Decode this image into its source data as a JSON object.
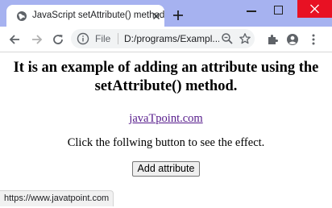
{
  "tab": {
    "title": "JavaScript setAttribute() method"
  },
  "omnibox": {
    "scheme_label": "File",
    "url": "D:/programs/Exampl..."
  },
  "page": {
    "heading": "It is an example of adding an attribute using the setAttribute() method.",
    "link_text": "javaTpoint.com",
    "instruction": "Click the follwing button to see the effect.",
    "button_label": "Add attribute"
  },
  "status": {
    "hover_url": "https://www.javatpoint.com"
  },
  "colors": {
    "titlebar": "#a6b2f0",
    "close_button": "#e81123",
    "link": "#551a8b"
  }
}
